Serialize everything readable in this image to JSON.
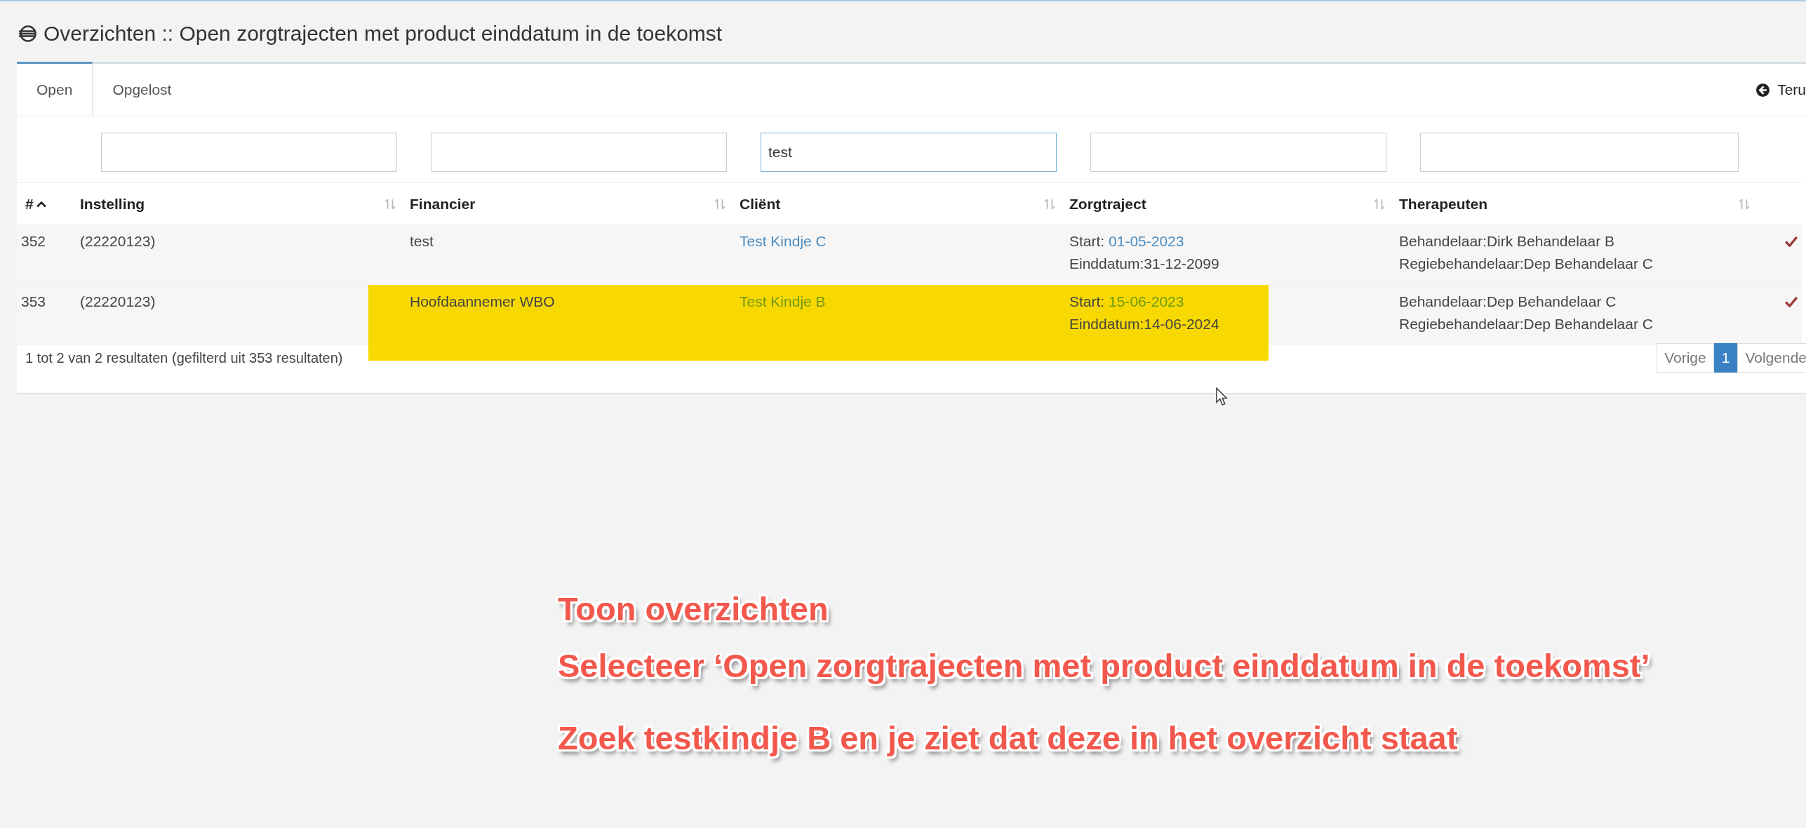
{
  "page_title": "Overzichten :: Open zorgtrajecten met product einddatum in de toekomst",
  "tabs": [
    {
      "label": "Open",
      "selected": true
    },
    {
      "label": "Opgelost",
      "selected": false
    }
  ],
  "back_link": "Teru",
  "filters": [
    {
      "focused": false
    },
    {
      "focused": false
    },
    {
      "focused": true,
      "value": "test"
    },
    {
      "focused": false
    },
    {
      "focused": false
    }
  ],
  "table": {
    "columns": [
      {
        "label": "#",
        "sorted": true
      },
      {
        "label": "Instelling",
        "sorted": false
      },
      {
        "label": "Financier",
        "sorted": false
      },
      {
        "label": "Cliënt",
        "sorted": false
      },
      {
        "label": "Zorgtraject",
        "sorted": false
      },
      {
        "label": "Therapeuten",
        "sorted": false
      }
    ],
    "rows": [
      {
        "number": "352",
        "instelling": "(22220123)",
        "financier": "test",
        "client": "Test Kindje C",
        "start_label": "Start:",
        "start_date": "01-05-2023",
        "end": "Einddatum:31-12-2099",
        "therapeuten": [
          "Behandelaar:Dirk Behandelaar B",
          "Regiebehandelaar:Dep Behandelaar C"
        ],
        "checked": true,
        "highlighted": false
      },
      {
        "number": "353",
        "instelling": "(22220123)",
        "financier": "Hoofdaannemer WBO",
        "client": "Test Kindje B",
        "start_label": "Start:",
        "start_date": "15-06-2023",
        "end": "Einddatum:14-06-2024",
        "therapeuten": [
          "Behandelaar:Dep Behandelaar C",
          "Regiebehandelaar:Dep Behandelaar C"
        ],
        "checked": true,
        "highlighted": true
      }
    ]
  },
  "results_info": "1 tot 2 van 2 resultaten (gefilterd uit 353 resultaten)",
  "pagination": [
    {
      "label": "Vorige",
      "selected": false
    },
    {
      "label": "1",
      "selected": true
    },
    {
      "label": "Volgende",
      "selected": false
    }
  ],
  "instructions": [
    "Toon overzichten",
    "Selecteer ‘Open zorgtrajecten met product einddatum in de toekomst’",
    "Zoek testkindje B en je ziet dat deze in het overzicht staat"
  ]
}
